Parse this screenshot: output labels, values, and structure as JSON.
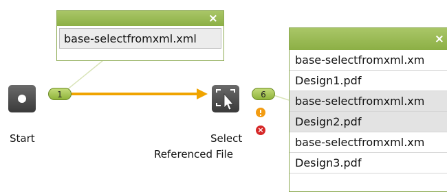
{
  "workflow": {
    "start_node": {
      "label": "Start",
      "count_badge": "1"
    },
    "select_node": {
      "label_line1": "Select",
      "label_line2": "Referenced File",
      "count_badge": "6"
    },
    "input_popup": {
      "close_glyph": "×",
      "items": [
        "base-selectfromxml.xml"
      ]
    },
    "output_popup": {
      "close_glyph": "×",
      "items": [
        "base-selectfromxml.xm",
        "Design1.pdf",
        "base-selectfromxml.xm",
        "Design2.pdf",
        "base-selectfromxml.xm",
        "Design3.pdf"
      ]
    },
    "colors": {
      "header_green": "#8caf45",
      "connector_orange": "#f0a400",
      "warning_orange": "#f39c12",
      "error_red": "#d62828"
    }
  }
}
